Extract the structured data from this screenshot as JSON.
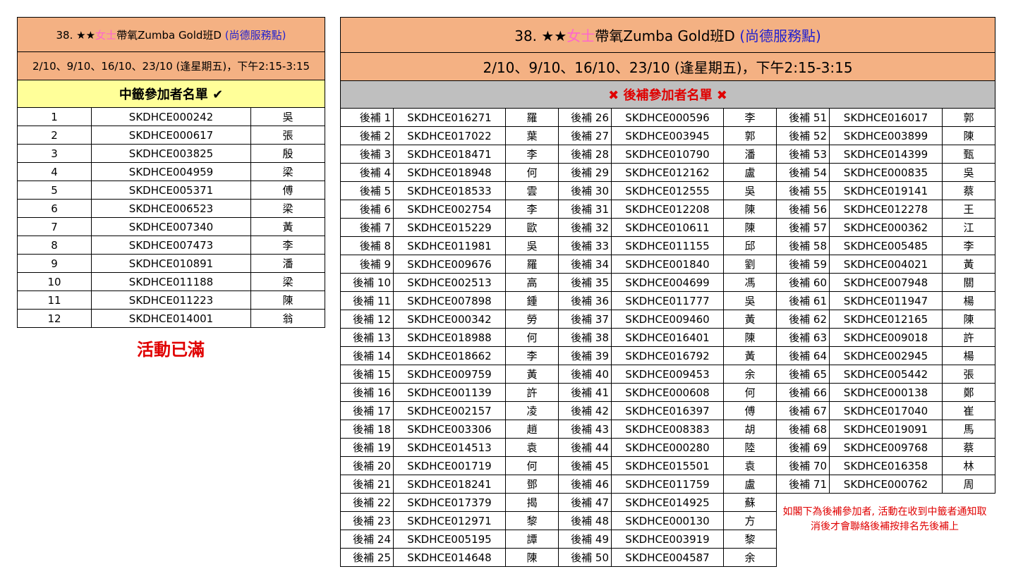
{
  "class_title": {
    "prefix": "38. ★★",
    "highlight": "女士",
    "main": "帶氧Zumba Gold班D ",
    "location": "(尚德服務點)"
  },
  "schedule": "2/10、9/10、16/10、23/10 (逢星期五)，下午2:15-3:15",
  "selected": {
    "header": "中籤參加者名單",
    "header_icon": "check-icon",
    "rows": [
      {
        "no": "1",
        "id": "SKDHCE000242",
        "name": "吳"
      },
      {
        "no": "2",
        "id": "SKDHCE000617",
        "name": "張"
      },
      {
        "no": "3",
        "id": "SKDHCE003825",
        "name": "殷"
      },
      {
        "no": "4",
        "id": "SKDHCE004959",
        "name": "梁"
      },
      {
        "no": "5",
        "id": "SKDHCE005371",
        "name": "傅"
      },
      {
        "no": "6",
        "id": "SKDHCE006523",
        "name": "梁"
      },
      {
        "no": "7",
        "id": "SKDHCE007340",
        "name": "黃"
      },
      {
        "no": "8",
        "id": "SKDHCE007473",
        "name": "李"
      },
      {
        "no": "9",
        "id": "SKDHCE010891",
        "name": "潘"
      },
      {
        "no": "10",
        "id": "SKDHCE011188",
        "name": "梁"
      },
      {
        "no": "11",
        "id": "SKDHCE011223",
        "name": "陳"
      },
      {
        "no": "12",
        "id": "SKDHCE014001",
        "name": "翁"
      }
    ]
  },
  "full_notice": "活動已滿",
  "waitlist": {
    "header": "後補參加者名單",
    "header_icon": "cross-icon",
    "rows": [
      {
        "label": "後補 1",
        "id": "SKDHCE016271",
        "name": "羅"
      },
      {
        "label": "後補 2",
        "id": "SKDHCE017022",
        "name": "葉"
      },
      {
        "label": "後補 3",
        "id": "SKDHCE018471",
        "name": "李"
      },
      {
        "label": "後補 4",
        "id": "SKDHCE018948",
        "name": "何"
      },
      {
        "label": "後補 5",
        "id": "SKDHCE018533",
        "name": "雲"
      },
      {
        "label": "後補 6",
        "id": "SKDHCE002754",
        "name": "李"
      },
      {
        "label": "後補 7",
        "id": "SKDHCE015229",
        "name": "歐"
      },
      {
        "label": "後補 8",
        "id": "SKDHCE011981",
        "name": "吳"
      },
      {
        "label": "後補 9",
        "id": "SKDHCE009676",
        "name": "羅"
      },
      {
        "label": "後補 10",
        "id": "SKDHCE002513",
        "name": "高"
      },
      {
        "label": "後補 11",
        "id": "SKDHCE007898",
        "name": "鍾"
      },
      {
        "label": "後補 12",
        "id": "SKDHCE000342",
        "name": "勞"
      },
      {
        "label": "後補 13",
        "id": "SKDHCE018988",
        "name": "何"
      },
      {
        "label": "後補 14",
        "id": "SKDHCE018662",
        "name": "李"
      },
      {
        "label": "後補 15",
        "id": "SKDHCE009759",
        "name": "黃"
      },
      {
        "label": "後補 16",
        "id": "SKDHCE001139",
        "name": "許"
      },
      {
        "label": "後補 17",
        "id": "SKDHCE002157",
        "name": "凌"
      },
      {
        "label": "後補 18",
        "id": "SKDHCE003306",
        "name": "趙"
      },
      {
        "label": "後補 19",
        "id": "SKDHCE014513",
        "name": "袁"
      },
      {
        "label": "後補 20",
        "id": "SKDHCE001719",
        "name": "何"
      },
      {
        "label": "後補 21",
        "id": "SKDHCE018241",
        "name": "鄧"
      },
      {
        "label": "後補 22",
        "id": "SKDHCE017379",
        "name": "揭"
      },
      {
        "label": "後補 23",
        "id": "SKDHCE012971",
        "name": "黎"
      },
      {
        "label": "後補 24",
        "id": "SKDHCE005195",
        "name": "譚"
      },
      {
        "label": "後補 25",
        "id": "SKDHCE014648",
        "name": "陳"
      },
      {
        "label": "後補 26",
        "id": "SKDHCE000596",
        "name": "李"
      },
      {
        "label": "後補 27",
        "id": "SKDHCE003945",
        "name": "郭"
      },
      {
        "label": "後補 28",
        "id": "SKDHCE010790",
        "name": "潘"
      },
      {
        "label": "後補 29",
        "id": "SKDHCE012162",
        "name": "盧"
      },
      {
        "label": "後補 30",
        "id": "SKDHCE012555",
        "name": "吳"
      },
      {
        "label": "後補 31",
        "id": "SKDHCE012208",
        "name": "陳"
      },
      {
        "label": "後補 32",
        "id": "SKDHCE010611",
        "name": "陳"
      },
      {
        "label": "後補 33",
        "id": "SKDHCE011155",
        "name": "邱"
      },
      {
        "label": "後補 34",
        "id": "SKDHCE001840",
        "name": "劉"
      },
      {
        "label": "後補 35",
        "id": "SKDHCE004699",
        "name": "馮"
      },
      {
        "label": "後補 36",
        "id": "SKDHCE011777",
        "name": "吳"
      },
      {
        "label": "後補 37",
        "id": "SKDHCE009460",
        "name": "黃"
      },
      {
        "label": "後補 38",
        "id": "SKDHCE016401",
        "name": "陳"
      },
      {
        "label": "後補 39",
        "id": "SKDHCE016792",
        "name": "黃"
      },
      {
        "label": "後補 40",
        "id": "SKDHCE009453",
        "name": "余"
      },
      {
        "label": "後補 41",
        "id": "SKDHCE000608",
        "name": "何"
      },
      {
        "label": "後補 42",
        "id": "SKDHCE016397",
        "name": "傅"
      },
      {
        "label": "後補 43",
        "id": "SKDHCE008383",
        "name": "胡"
      },
      {
        "label": "後補 44",
        "id": "SKDHCE000280",
        "name": "陸"
      },
      {
        "label": "後補 45",
        "id": "SKDHCE015501",
        "name": "袁"
      },
      {
        "label": "後補 46",
        "id": "SKDHCE011759",
        "name": "盧"
      },
      {
        "label": "後補 47",
        "id": "SKDHCE014925",
        "name": "蘇"
      },
      {
        "label": "後補 48",
        "id": "SKDHCE000130",
        "name": "方"
      },
      {
        "label": "後補 49",
        "id": "SKDHCE003919",
        "name": "黎"
      },
      {
        "label": "後補 50",
        "id": "SKDHCE004587",
        "name": "余"
      },
      {
        "label": "後補 51",
        "id": "SKDHCE016017",
        "name": "郭"
      },
      {
        "label": "後補 52",
        "id": "SKDHCE003899",
        "name": "陳"
      },
      {
        "label": "後補 53",
        "id": "SKDHCE014399",
        "name": "甄"
      },
      {
        "label": "後補 54",
        "id": "SKDHCE000835",
        "name": "吳"
      },
      {
        "label": "後補 55",
        "id": "SKDHCE019141",
        "name": "蔡"
      },
      {
        "label": "後補 56",
        "id": "SKDHCE012278",
        "name": "王"
      },
      {
        "label": "後補 57",
        "id": "SKDHCE000362",
        "name": "江"
      },
      {
        "label": "後補 58",
        "id": "SKDHCE005485",
        "name": "李"
      },
      {
        "label": "後補 59",
        "id": "SKDHCE004021",
        "name": "黃"
      },
      {
        "label": "後補 60",
        "id": "SKDHCE007948",
        "name": "關"
      },
      {
        "label": "後補 61",
        "id": "SKDHCE011947",
        "name": "楊"
      },
      {
        "label": "後補 62",
        "id": "SKDHCE012165",
        "name": "陳"
      },
      {
        "label": "後補 63",
        "id": "SKDHCE009018",
        "name": "許"
      },
      {
        "label": "後補 64",
        "id": "SKDHCE002945",
        "name": "楊"
      },
      {
        "label": "後補 65",
        "id": "SKDHCE005442",
        "name": "張"
      },
      {
        "label": "後補 66",
        "id": "SKDHCE000138",
        "name": "鄭"
      },
      {
        "label": "後補 67",
        "id": "SKDHCE017040",
        "name": "崔"
      },
      {
        "label": "後補 68",
        "id": "SKDHCE019091",
        "name": "馬"
      },
      {
        "label": "後補 69",
        "id": "SKDHCE009768",
        "name": "蔡"
      },
      {
        "label": "後補 70",
        "id": "SKDHCE016358",
        "name": "林"
      },
      {
        "label": "後補 71",
        "id": "SKDHCE000762",
        "name": "周"
      }
    ]
  },
  "waitlist_note": "如閣下為後補參加者, 活動在收到中籤者通知取消後才會聯絡後補按排名先後補上",
  "colors": {
    "header_orange": "#f4b183",
    "header_yellow": "#ffff99",
    "header_gray": "#bfbfbf",
    "alert_red": "#e00000",
    "highlight_pink": "#ff66cc",
    "location_blue": "#2020d0"
  }
}
